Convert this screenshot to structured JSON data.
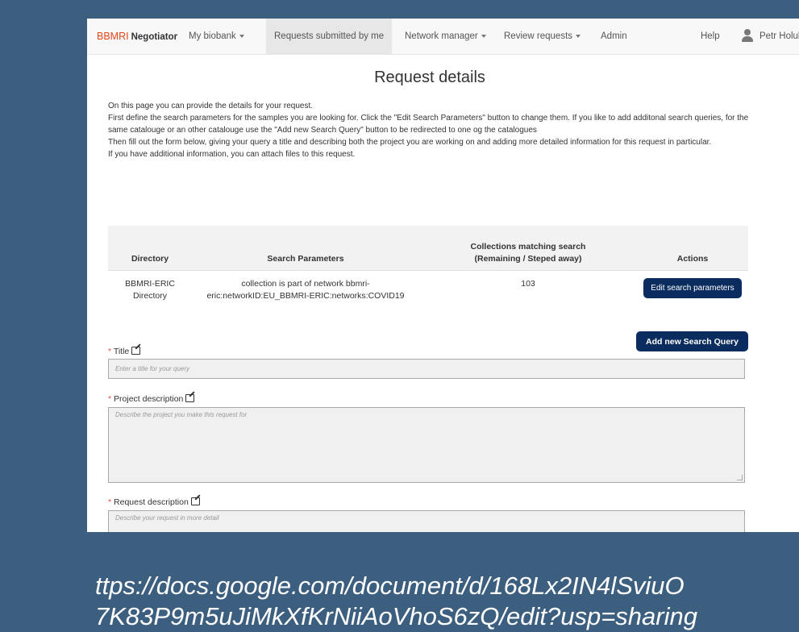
{
  "navbar": {
    "brand_bbmri": "BBMRI",
    "brand_negotiator": "Negotiator",
    "my_biobank": "My biobank",
    "requests_submitted": "Requests submitted by me",
    "network_manager": "Network manager",
    "review_requests": "Review requests",
    "admin": "Admin",
    "help": "Help",
    "user_name": "Petr Holub"
  },
  "page": {
    "title": "Request details",
    "intro": [
      "On this page you can provide the details for your request.",
      "First define the search parameters for the samples you are looking for. Click the \"Edit Search Parameters\" button to change them. If you like to add additonal search queries, for the same catalouge or an other catalouge use the \"Add new Search Query\" button to be redirected to one og the catalogues",
      "Then fill out the form below, giving your query a title and describing both the project you are working on and adding more detailed information for this request in particular.",
      "If you have additional information, you can attach files to this request."
    ]
  },
  "table": {
    "headers": {
      "directory": "Directory",
      "search_parameters": "Search Parameters",
      "collections": "Collections matching search (Remaining / Steped away)",
      "actions": "Actions"
    },
    "rows": [
      {
        "directory": "BBMRI-ERIC Directory",
        "search_parameters": "collection is part of network bbmri-eric:networkID:EU_BBMRI-ERIC:networks:COVID19",
        "collections": "103",
        "action_label": "Edit search parameters"
      }
    ]
  },
  "add_query_label": "Add new Search Query",
  "form": {
    "required_mark": "*",
    "title_label": "Title",
    "title_placeholder": "Enter a title for your query",
    "project_label": "Project description",
    "project_placeholder": "Describe the project you make this request for",
    "request_label": "Request description",
    "request_placeholder": "Describe your request in more detail"
  },
  "url_overlay": {
    "line1": "ttps://docs.google.com/document/d/168Lx2IN4lSviuO",
    "line2": "7K83P9m5uJiMkXfKrNiiAoVhoS6zQ/edit?usp=sharing"
  },
  "colors": {
    "background": "#3c5f80",
    "brand": "#e3461b",
    "button": "#0a2c5e",
    "required": "#d9534f"
  }
}
